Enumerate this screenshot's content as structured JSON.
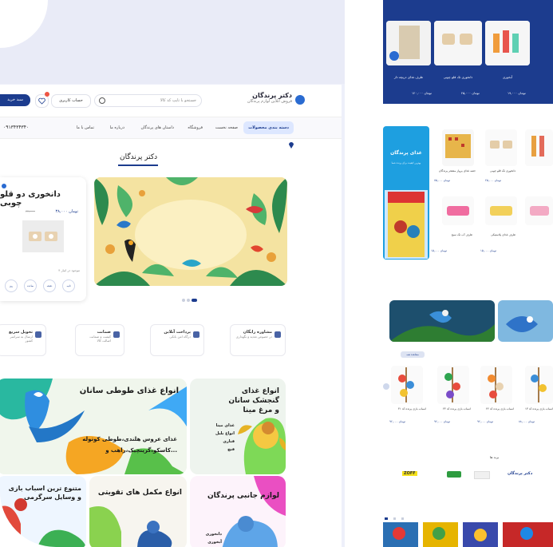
{
  "header": {
    "logo_title": "دکتر پرندگان",
    "logo_subtitle": "فروش آنلاین لوازم پرندگان",
    "search_placeholder": "جستجو با تایپ کد کالا",
    "account_label": "حساب کاربری",
    "cart_label": "سبد خرید",
    "wishlist_count": "0"
  },
  "nav": {
    "categories": "دسته بندی محصولات",
    "items": [
      "صفحه نخست",
      "فروشگاه",
      "داستان های پرندگان",
      "درباره ما",
      "تماس با ما"
    ],
    "phone": "۰۹۱۳۴۳۴۳۴۰"
  },
  "section": {
    "title": "دکتر پرندگان"
  },
  "product_card": {
    "title": "دانخوری دو قلو چوبی",
    "price": "۳۸,۰۰۰ تومان",
    "old_price": "۴۲,۰۰۰",
    "stock": "۴ موجود در انبار",
    "timer": [
      "روز",
      "ساعت",
      "دقیقه",
      "ثانیه"
    ]
  },
  "features": [
    {
      "title": "مشاوره رایگان",
      "subtitle": "در خصوص تغذیه و نگهداری"
    },
    {
      "title": "پرداخت آنلاین",
      "subtitle": "درگاه امن بانکی"
    },
    {
      "title": "ضمانت",
      "subtitle": "کیفیت و ضمانت اصالت کالا"
    },
    {
      "title": "تحویل سریع",
      "subtitle": "ارسال به سراسر کشور"
    }
  ],
  "banners": [
    {
      "name": "mina",
      "title": "انواع غذای گنجشک سانان و مرغ مینا",
      "lines": [
        "غذای مینا",
        "انواع بلبل",
        "قناری",
        "فنچ"
      ]
    },
    {
      "name": "parrot-food",
      "title": "انواع غذای طوطی سانان",
      "lines": [
        "غذای عروس هلندی،طوطی کوتوله",
        "کاسکو،گرینچیک،راهب و..."
      ]
    },
    {
      "name": "accessories",
      "title": "لوازم جانبی پرندگان",
      "lines": [
        "دانخوری",
        "آبخوری"
      ]
    },
    {
      "name": "supplements",
      "title": "انواع مکمل های تقویتی",
      "lines": []
    },
    {
      "name": "toys",
      "title": "متنوع ترین اسباب بازی و وسایل سرگرمی",
      "lines": []
    }
  ],
  "right": {
    "top_products": [
      {
        "title": "ظرف غذای دریچه دار",
        "price": "۱۲۰,۰۰۰ تومان"
      },
      {
        "title": "دانخوری تک قلو چوبی",
        "price": "۲۵,۰۰۰ تومان"
      },
      {
        "title": "آبخوری",
        "price": "۱۹,۰۰۰ تومان"
      }
    ],
    "side_banner": {
      "title": "غذای پرندگان",
      "subtitle": "بهترین کیفیت برای پرنده شما"
    },
    "grid_products": [
      {
        "title": "دانخوری تک قلو چوبی",
        "price": "۲۵,۰۰۰ تومان"
      },
      {
        "title": "جعبه غذای پرواز مشجر پرندگان",
        "price": "۷۵,۰۰۰ تومان"
      },
      {
        "title": "ظرف غذای پلاستیکی",
        "price": "۱۵,۰۰۰ تومان"
      },
      {
        "title": "ظرف آب تک سیخ",
        "price": "۱۵,۰۰۰ تومان"
      },
      {
        "title": "ظرف آب پلاستیکی",
        "price": "۱۵,۰۰۰ تومان"
      }
    ],
    "toy_products": [
      {
        "title": "اسباب بازی پرنده کد ۴۱",
        "price": "۹۶,۰۰۰ تومان"
      },
      {
        "title": "اسباب بازی پرنده کد ۲۴",
        "price": "۹۶,۰۰۰ تومان"
      },
      {
        "title": "اسباب بازی پرنده کد ۲۲",
        "price": "۹۶,۰۰۰ تومان"
      },
      {
        "title": "اسباب بازی پرنده کد ۱۳",
        "price": "۸۸,۰۰۰ تومان"
      }
    ],
    "view_all": "مشاهده همه",
    "brands_title": "برند ها",
    "brands": [
      "دکتر پرندگان",
      "",
      "",
      "ZOFF"
    ]
  },
  "colors": {
    "primary": "#1c3c8e",
    "accent": "#1e9fe0"
  }
}
